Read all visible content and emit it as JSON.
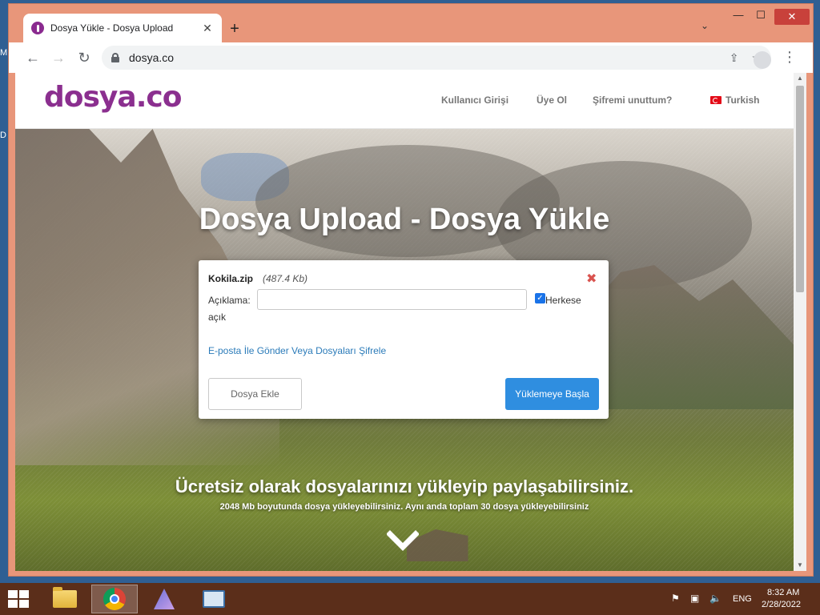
{
  "desktop": {
    "edge_text_top": "M",
    "edge_text_mid": "D"
  },
  "browser": {
    "tab": {
      "title": "Dosya Yükle - Dosya Upload",
      "close": "✕"
    },
    "new_tab": "+",
    "tab_search": "⌄",
    "window_controls": {
      "minimize": "—",
      "maximize": "☐",
      "close": "✕"
    },
    "nav": {
      "back": "←",
      "forward": "→",
      "reload": "↻"
    },
    "address": {
      "url": "dosya.co"
    },
    "omni_icons": {
      "share": "⇪",
      "bookmark": "☆"
    },
    "menu": "⋮"
  },
  "site": {
    "logo": "dosya.co",
    "nav": {
      "login": "Kullanıcı Girişi",
      "register": "Üye Ol",
      "forgot": "Şifremi unuttum?",
      "language": "Turkish"
    },
    "hero": {
      "title": "Dosya Upload - Dosya Yükle",
      "tagline": "Ücretsiz olarak dosyalarınızı yükleyip paylaşabilirsiniz.",
      "subtext": "2048 Mb boyutunda dosya yükleyebilirsiniz. Aynı anda toplam 30 dosya yükleyebilirsiniz"
    },
    "upload": {
      "file_name": "Kokila.zip",
      "file_size": "(487.4 Kb)",
      "close": "✖",
      "description_label": "Açıklama:",
      "description_value": "",
      "public_checked": true,
      "public_label_part1": "Herkese",
      "public_label_part2": "açık",
      "email_link": "E-posta İle Gönder Veya Dosyaları Şifrele",
      "add_file": "Dosya Ekle",
      "start_upload": "Yüklemeye Başla"
    }
  },
  "taskbar": {
    "tray": {
      "lang": "ENG",
      "time": "8:32 AM",
      "date": "2/28/2022"
    }
  }
}
